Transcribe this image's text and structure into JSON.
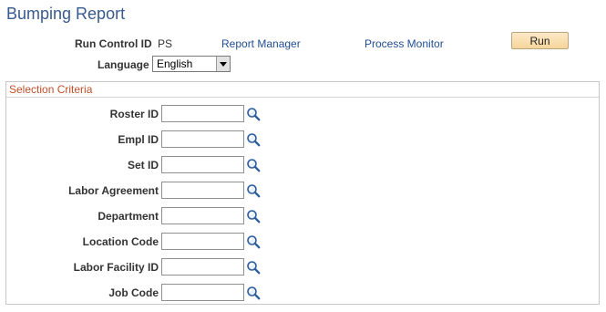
{
  "page": {
    "title": "Bumping Report"
  },
  "header": {
    "run_control_label": "Run Control ID",
    "run_control_value": "PS",
    "report_manager": "Report Manager",
    "process_monitor": "Process Monitor",
    "run_button": "Run",
    "language_label": "Language",
    "language_value": "English"
  },
  "criteria": {
    "title": "Selection Criteria",
    "fields": [
      {
        "label": "Roster ID",
        "value": ""
      },
      {
        "label": "Empl ID",
        "value": ""
      },
      {
        "label": "Set ID",
        "value": ""
      },
      {
        "label": "Labor Agreement",
        "value": ""
      },
      {
        "label": "Department",
        "value": ""
      },
      {
        "label": "Location Code",
        "value": ""
      },
      {
        "label": "Labor Facility ID",
        "value": ""
      },
      {
        "label": "Job Code",
        "value": ""
      }
    ]
  },
  "colors": {
    "title": "#375a8f",
    "link": "#1f4e93",
    "section_title": "#c0502b"
  },
  "icons": {
    "lookup": "magnifier-icon"
  }
}
